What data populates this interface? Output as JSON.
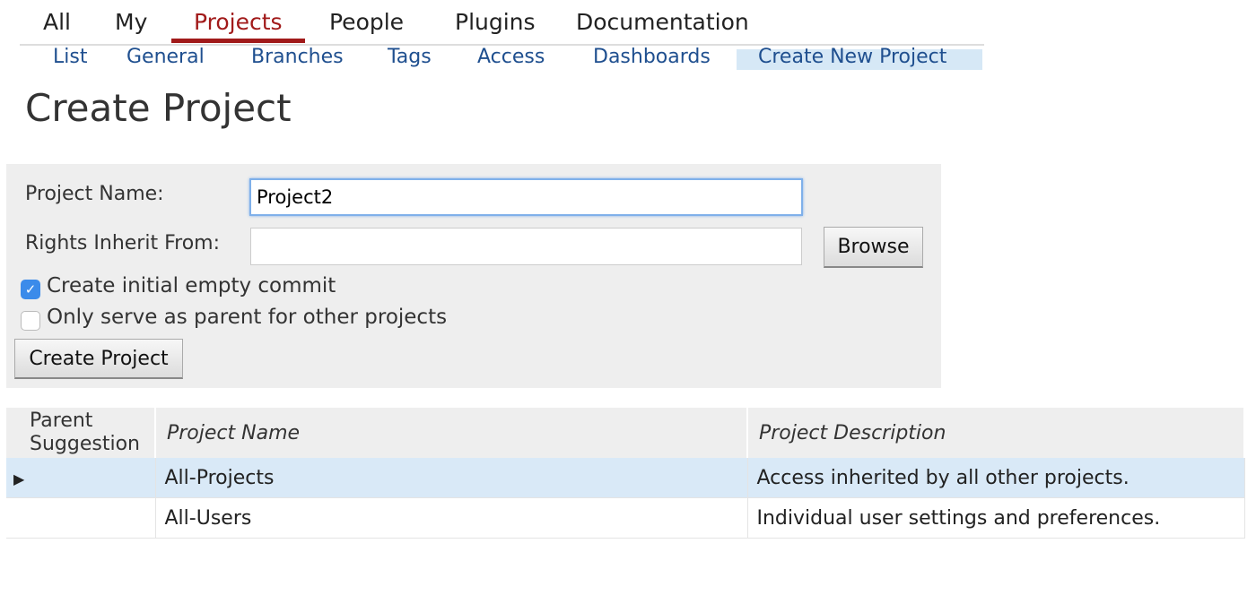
{
  "top_tabs": [
    {
      "label": "All"
    },
    {
      "label": "My"
    },
    {
      "label": "Projects",
      "active": true
    },
    {
      "label": "People"
    },
    {
      "label": "Plugins"
    },
    {
      "label": "Documentation"
    }
  ],
  "sub_tabs": [
    {
      "label": "List"
    },
    {
      "label": "General"
    },
    {
      "label": "Branches"
    },
    {
      "label": "Tags"
    },
    {
      "label": "Access"
    },
    {
      "label": "Dashboards"
    },
    {
      "label": "Create New Project",
      "active": true
    }
  ],
  "page_title": "Create Project",
  "form": {
    "project_name_label": "Project Name:",
    "project_name_value": "Project2",
    "rights_label": "Rights Inherit From:",
    "rights_value": "",
    "browse_label": "Browse",
    "initial_commit_label": "Create initial empty commit",
    "initial_commit_checked": true,
    "parent_only_label": "Only serve as parent for other projects",
    "parent_only_checked": false,
    "create_label": "Create Project"
  },
  "table": {
    "headers": [
      "Parent Suggestion",
      "Project Name",
      "Project Description"
    ],
    "rows": [
      {
        "name": "All-Projects",
        "description": "Access inherited by all other projects.",
        "selected": true
      },
      {
        "name": "All-Users",
        "description": "Individual user settings and preferences.",
        "selected": false
      }
    ]
  },
  "colors": {
    "accent_red": "#a11a1a",
    "link_blue": "#1f4f8f",
    "selected_row": "#d9e9f7",
    "focus_blue": "#7fb0ea",
    "checkbox_blue": "#3b8bea"
  }
}
